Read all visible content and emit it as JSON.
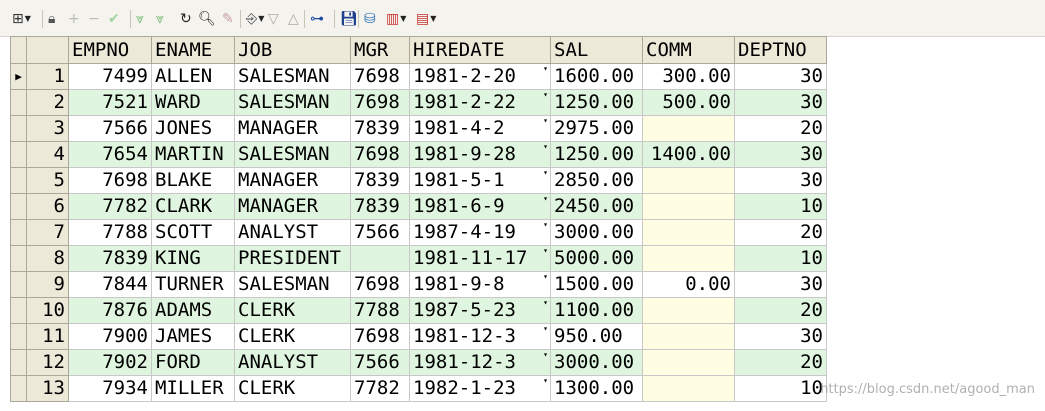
{
  "toolbar": {
    "icons": [
      {
        "name": "grid-view-icon",
        "glyph": "⊞",
        "caret": true,
        "color": "#333333"
      },
      {
        "name": "lock-icon",
        "glyph": "🔒︎",
        "color": "#555555"
      },
      {
        "name": "add-record-icon",
        "glyph": "+",
        "color": "#b9b9b9"
      },
      {
        "name": "delete-record-icon",
        "glyph": "−",
        "color": "#b9b9b9"
      },
      {
        "name": "post-changes-icon",
        "glyph": "✔",
        "color": "#9fd49f"
      },
      {
        "name": "next-page-icon",
        "glyph": "⩔",
        "color": "#7fbf7f"
      },
      {
        "name": "last-page-icon",
        "glyph": "⩔",
        "color": "#7fbf7f"
      },
      {
        "name": "refresh-icon",
        "glyph": "↻",
        "color": "#222222"
      },
      {
        "name": "find-icon",
        "glyph": "🔍︎",
        "color": "#222222"
      },
      {
        "name": "clear-icon",
        "glyph": "✎",
        "color": "#c4a0a0"
      },
      {
        "name": "export-icon",
        "glyph": "⎆",
        "caret": true,
        "color": "#444444"
      },
      {
        "name": "sort-down-icon",
        "glyph": "▽",
        "color": "#aaaaaa"
      },
      {
        "name": "sort-up-icon",
        "glyph": "△",
        "color": "#aaaaaa"
      },
      {
        "name": "query-builder-icon",
        "glyph": "⊶",
        "color": "#1f4aa0"
      },
      {
        "name": "save-icon",
        "glyph": "💾︎",
        "color": "#1f3f8f"
      },
      {
        "name": "database-icon",
        "glyph": "⛁",
        "color": "#2d6fb3"
      },
      {
        "name": "chart-icon",
        "glyph": "▥",
        "caret": true,
        "color": "#c83232"
      },
      {
        "name": "report-icon",
        "glyph": "▤",
        "caret": true,
        "color": "#c83232"
      }
    ]
  },
  "colors": {
    "header_bg": "#ece9d8",
    "row_alt_bg": "#dff5df",
    "empty_comm_bg": "#fffde2"
  },
  "grid": {
    "columns": [
      "EMPNO",
      "ENAME",
      "JOB",
      "MGR",
      "HIREDATE",
      "SAL",
      "COMM",
      "DEPTNO"
    ],
    "rows": [
      {
        "rownum": "1",
        "empno": "7499",
        "ename": "ALLEN",
        "job": "SALESMAN",
        "mgr": "7698",
        "hiredate": "1981-2-20",
        "sal": "1600.00",
        "comm": "300.00",
        "deptno": "30"
      },
      {
        "rownum": "2",
        "empno": "7521",
        "ename": "WARD",
        "job": "SALESMAN",
        "mgr": "7698",
        "hiredate": "1981-2-22",
        "sal": "1250.00",
        "comm": "500.00",
        "deptno": "30"
      },
      {
        "rownum": "3",
        "empno": "7566",
        "ename": "JONES",
        "job": "MANAGER",
        "mgr": "7839",
        "hiredate": "1981-4-2",
        "sal": "2975.00",
        "comm": "",
        "deptno": "20"
      },
      {
        "rownum": "4",
        "empno": "7654",
        "ename": "MARTIN",
        "job": "SALESMAN",
        "mgr": "7698",
        "hiredate": "1981-9-28",
        "sal": "1250.00",
        "comm": "1400.00",
        "deptno": "30"
      },
      {
        "rownum": "5",
        "empno": "7698",
        "ename": "BLAKE",
        "job": "MANAGER",
        "mgr": "7839",
        "hiredate": "1981-5-1",
        "sal": "2850.00",
        "comm": "",
        "deptno": "30"
      },
      {
        "rownum": "6",
        "empno": "7782",
        "ename": "CLARK",
        "job": "MANAGER",
        "mgr": "7839",
        "hiredate": "1981-6-9",
        "sal": "2450.00",
        "comm": "",
        "deptno": "10"
      },
      {
        "rownum": "7",
        "empno": "7788",
        "ename": "SCOTT",
        "job": "ANALYST",
        "mgr": "7566",
        "hiredate": "1987-4-19",
        "sal": "3000.00",
        "comm": "",
        "deptno": "20"
      },
      {
        "rownum": "8",
        "empno": "7839",
        "ename": "KING",
        "job": "PRESIDENT",
        "mgr": "",
        "hiredate": "1981-11-17",
        "sal": "5000.00",
        "comm": "",
        "deptno": "10"
      },
      {
        "rownum": "9",
        "empno": "7844",
        "ename": "TURNER",
        "job": "SALESMAN",
        "mgr": "7698",
        "hiredate": "1981-9-8",
        "sal": "1500.00",
        "comm": "0.00",
        "deptno": "30"
      },
      {
        "rownum": "10",
        "empno": "7876",
        "ename": "ADAMS",
        "job": "CLERK",
        "mgr": "7788",
        "hiredate": "1987-5-23",
        "sal": "1100.00",
        "comm": "",
        "deptno": "20"
      },
      {
        "rownum": "11",
        "empno": "7900",
        "ename": "JAMES",
        "job": "CLERK",
        "mgr": "7698",
        "hiredate": "1981-12-3",
        "sal": "950.00",
        "comm": "",
        "deptno": "30"
      },
      {
        "rownum": "12",
        "empno": "7902",
        "ename": "FORD",
        "job": "ANALYST",
        "mgr": "7566",
        "hiredate": "1981-12-3",
        "sal": "3000.00",
        "comm": "",
        "deptno": "20"
      },
      {
        "rownum": "13",
        "empno": "7934",
        "ename": "MILLER",
        "job": "CLERK",
        "mgr": "7782",
        "hiredate": "1982-1-23",
        "sal": "1300.00",
        "comm": "",
        "deptno": "10"
      }
    ],
    "current_row_indicator": "▶"
  },
  "watermark": "https://blog.csdn.net/agood_man"
}
